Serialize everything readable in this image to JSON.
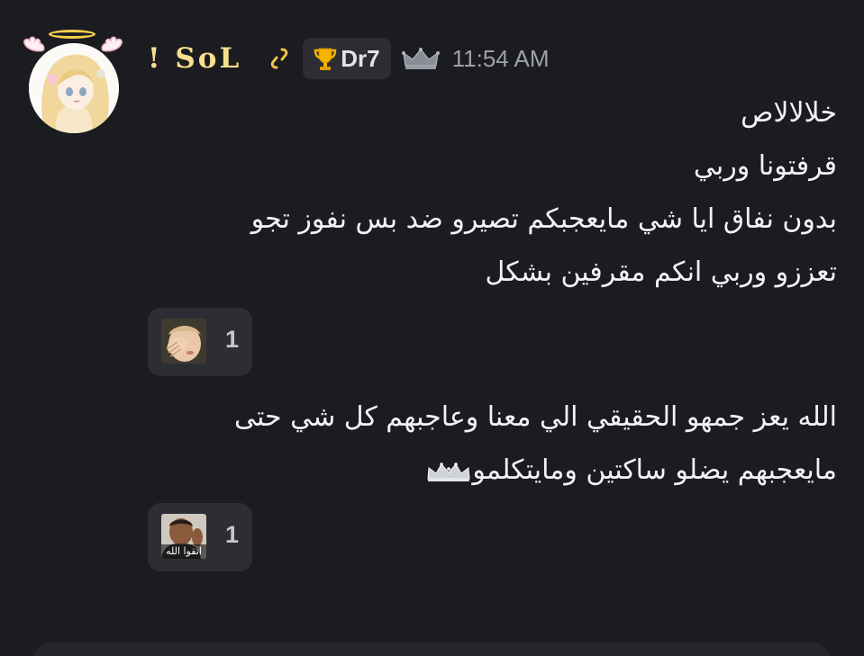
{
  "message": {
    "username": "! SoL",
    "tag": "Dr7",
    "timestamp": "11:54 AM",
    "lines_block1": [
      "خلالالاص",
      "قرفتونا وربي",
      "بدون نفاق ايا شي مايعجبكم تصيرو ضد بس نفوز تجو",
      "تعززو وربي انكم مقرفين بشكل"
    ],
    "lines_block2": [
      "الله يعز جمهو الحقيقي الي معنا وعاجبهم كل شي حتى",
      "مايعجبهم يضلو ساكتين ومايتكلمو"
    ]
  },
  "reactions": [
    {
      "count": "1",
      "emoji": "facepalm-baby-sticker"
    },
    {
      "count": "1",
      "emoji": "man-sticker",
      "caption": "اتقوا الله"
    }
  ],
  "icons": {
    "link": "link-icon",
    "trophy": "trophy-icon",
    "crown": "crown-icon"
  },
  "colors": {
    "background": "#1b1c20",
    "username": "#f6df8e",
    "timestamp": "#9da0a8",
    "pill": "#2c2e34"
  }
}
